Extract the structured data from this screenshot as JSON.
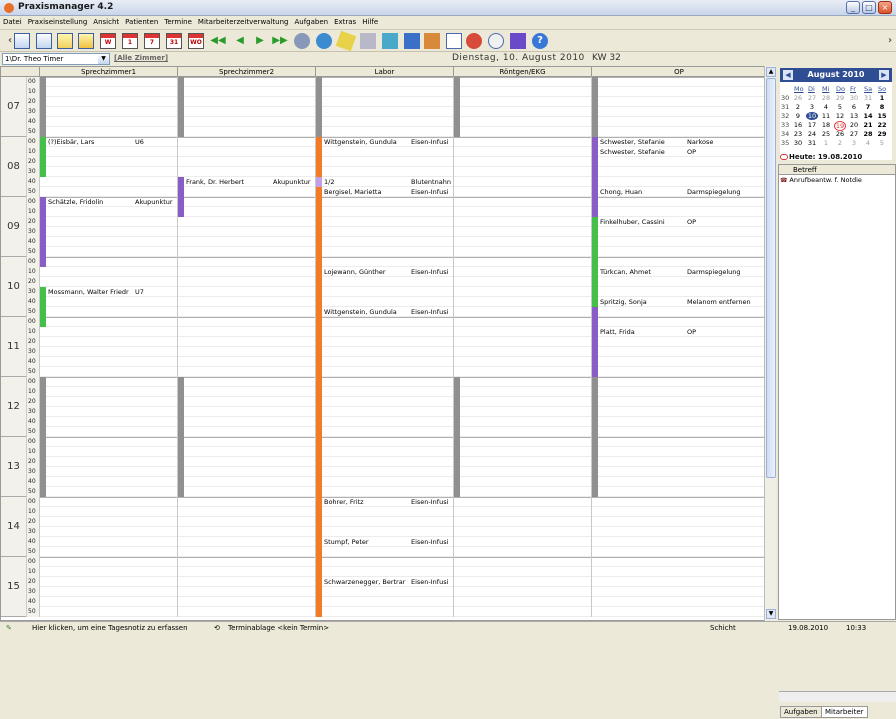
{
  "window": {
    "title": "Praxismanager 4.2"
  },
  "menu": [
    "Datei",
    "Praxiseinstellung",
    "Ansicht",
    "Patienten",
    "Termine",
    "Mitarbeiterzeitverwaltung",
    "Aufgaben",
    "Extras",
    "Hilfe"
  ],
  "toolbar": {
    "cal_labels": [
      "",
      "",
      "",
      "W",
      "1",
      "7",
      "31",
      "WO"
    ]
  },
  "filter": {
    "doctor": "1\\Dr. Theo Timer",
    "all_rooms": "[Alle Zimmer]",
    "date": "Dienstag, 10. August 2010",
    "kw": "KW 32"
  },
  "columns": [
    "Sprechzimmer1",
    "Sprechzimmer2",
    "Labor",
    "Röntgen/EKG",
    "OP"
  ],
  "hours": [
    "07",
    "08",
    "09",
    "10",
    "11",
    "12",
    "13",
    "14",
    "15"
  ],
  "minutes": [
    "00",
    "10",
    "20",
    "30",
    "40",
    "50"
  ],
  "appointments": [
    {
      "id": "a1",
      "col": 0,
      "slot": 6,
      "name": "(?)Eisbär, Lars",
      "type": "U6"
    },
    {
      "id": "a2",
      "col": 1,
      "slot": 10,
      "name": "Frank, Dr. Herbert",
      "type": "Akupunktur"
    },
    {
      "id": "a3",
      "col": 0,
      "slot": 12,
      "name": "Schätzle, Fridolin",
      "type": "Akupunktur"
    },
    {
      "id": "a4",
      "col": 0,
      "slot": 21,
      "name": "Mossmann, Walter Friedr",
      "type": "U7"
    },
    {
      "id": "a5",
      "col": 2,
      "slot": 6,
      "name": "Wittgenstein, Gundula",
      "type": "Eisen-Infusi"
    },
    {
      "id": "a6",
      "col": 2,
      "slot": 10,
      "name": "1/2",
      "type": "Blutentnahn"
    },
    {
      "id": "a7",
      "col": 2,
      "slot": 11,
      "name": "Bergisel, Marietta",
      "type": "Eisen-Infusi"
    },
    {
      "id": "a8",
      "col": 2,
      "slot": 19,
      "name": "Lojewann, Günther",
      "type": "Eisen-Infusi"
    },
    {
      "id": "a9",
      "col": 2,
      "slot": 23,
      "name": "Wittgenstein, Gundula",
      "type": "Eisen-Infusi"
    },
    {
      "id": "a10",
      "col": 2,
      "slot": 42,
      "name": "Bohrer, Fritz",
      "type": "Eisen-Infusi"
    },
    {
      "id": "a11",
      "col": 2,
      "slot": 46,
      "name": "Stumpf, Peter",
      "type": "Eisen-Infusi"
    },
    {
      "id": "a12",
      "col": 2,
      "slot": 50,
      "name": "Schwarzenegger, Bertrar",
      "type": "Eisen-Infusi"
    },
    {
      "id": "a13",
      "col": 4,
      "slot": 6,
      "name": "Schwester, Stefanie",
      "type": "Narkose"
    },
    {
      "id": "a14",
      "col": 4,
      "slot": 7,
      "name": "Schwester, Stefanie",
      "type": "OP"
    },
    {
      "id": "a15",
      "col": 4,
      "slot": 11,
      "name": "Chong, Huan",
      "type": "Darmspiegelung"
    },
    {
      "id": "a16",
      "col": 4,
      "slot": 14,
      "name": "Finkelhuber, Cassini",
      "type": "OP"
    },
    {
      "id": "a17",
      "col": 4,
      "slot": 19,
      "name": "Türkcan, Ahmet",
      "type": "Darmspiegelung"
    },
    {
      "id": "a18",
      "col": 4,
      "slot": 22,
      "name": "Spritzig, Sonja",
      "type": "Melanom entfernen"
    },
    {
      "id": "a19",
      "col": 4,
      "slot": 25,
      "name": "Platt, Frida",
      "type": "OP"
    }
  ],
  "calendar": {
    "month": "August 2010",
    "dow": [
      "Mo",
      "Di",
      "Mi",
      "Do",
      "Fr",
      "Sa",
      "So"
    ],
    "weeks": [
      {
        "wk": "30",
        "days": [
          "26",
          "27",
          "28",
          "29",
          "30",
          "31",
          "1"
        ]
      },
      {
        "wk": "31",
        "days": [
          "2",
          "3",
          "4",
          "5",
          "6",
          "7",
          "8"
        ]
      },
      {
        "wk": "32",
        "days": [
          "9",
          "10",
          "11",
          "12",
          "13",
          "14",
          "15"
        ]
      },
      {
        "wk": "33",
        "days": [
          "16",
          "17",
          "18",
          "19",
          "20",
          "21",
          "22"
        ]
      },
      {
        "wk": "34",
        "days": [
          "23",
          "24",
          "25",
          "26",
          "27",
          "28",
          "29"
        ]
      },
      {
        "wk": "35",
        "days": [
          "30",
          "31",
          "1",
          "2",
          "3",
          "4",
          "5"
        ]
      }
    ],
    "today": "Heute: 19.08.2010"
  },
  "tasks": {
    "header": "Betreff",
    "items": [
      "Anrufbeantw. f. Notdie"
    ]
  },
  "tabs": [
    "Aufgaben",
    "Mitarbeiter"
  ],
  "status": {
    "note": "Hier klicken, um eine Tagesnotiz zu erfassen",
    "template": "Terminablage <kein Termin>",
    "shift": "Schicht",
    "date": "19.08.2010",
    "time": "10:33"
  },
  "colors": {
    "gray": "#909090",
    "green": "#44c04a",
    "orange": "#f47a28",
    "purple": "#8a5cc8",
    "lavender": "#c0a0e8"
  }
}
